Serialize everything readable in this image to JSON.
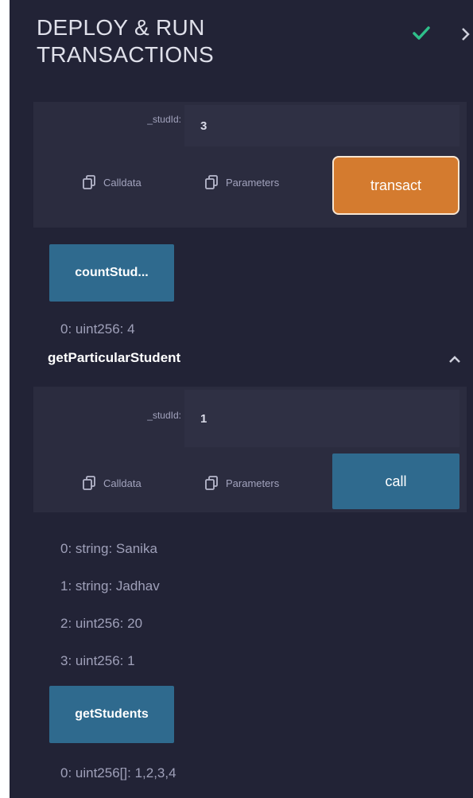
{
  "header": {
    "title_line1": "DEPLOY & RUN",
    "title_line2": "TRANSACTIONS"
  },
  "colors": {
    "panel_bg": "#222336",
    "accent_orange": "#d47b2f",
    "button_blue": "#2f6a8e",
    "check_green": "#2fbf8a"
  },
  "icons": [
    "check-icon",
    "chevron-right-icon",
    "copy-icon",
    "chevron-up-icon"
  ],
  "transact_block": {
    "param_label": "_studId:",
    "param_value": "3",
    "calldata_label": "Calldata",
    "parameters_label": "Parameters",
    "button_label": "transact"
  },
  "count_students": {
    "button_label": "countStud...",
    "output": "0: uint256: 4"
  },
  "get_particular_student": {
    "title": "getParticularStudent",
    "param_label": "_studId:",
    "param_value": "1",
    "calldata_label": "Calldata",
    "parameters_label": "Parameters",
    "button_label": "call",
    "outputs": [
      "0: string: Sanika",
      "1: string: Jadhav",
      "2: uint256: 20",
      "3: uint256: 1"
    ]
  },
  "get_students": {
    "button_label": "getStudents",
    "output": "0: uint256[]: 1,2,3,4"
  }
}
